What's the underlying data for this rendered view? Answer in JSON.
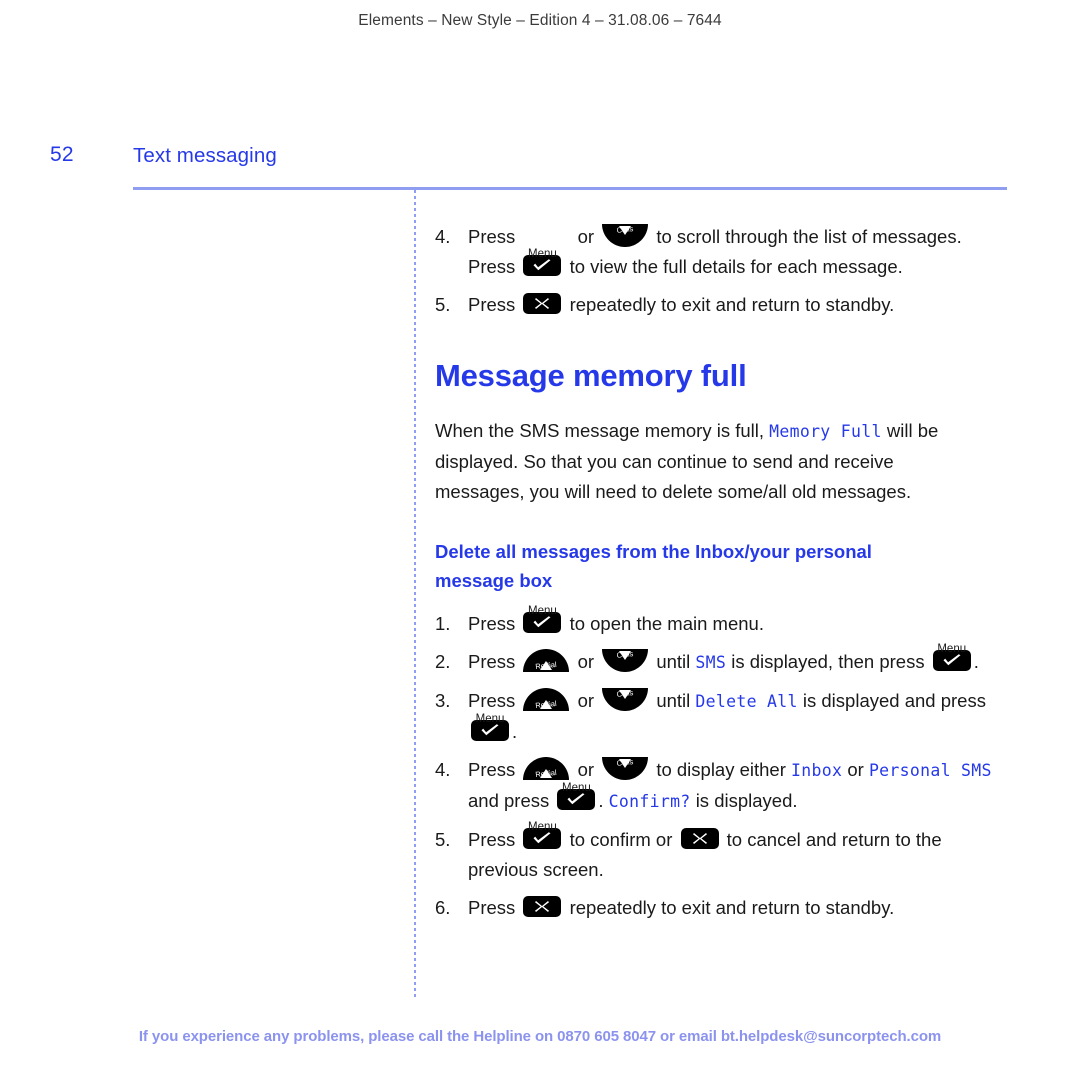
{
  "document": {
    "running_header": "Elements – New Style – Edition 4 – 31.08.06 – 7644",
    "folio": "52",
    "section_title": "Text messaging",
    "footer": "If you experience any problems, please call the Helpline on 0870 605 8047 or email bt.helpdesk@suncorptech.com"
  },
  "keys": {
    "menu_caption": "Menu",
    "redial_caption": "Redial",
    "calls_caption": "Calls"
  },
  "first_list": {
    "step4": {
      "num": "4.",
      "t1": "Press",
      "t2": "or",
      "t3": "to scroll through the list of messages.",
      "t4": "Press",
      "t5": "to view the full details for each message."
    },
    "step5": {
      "num": "5.",
      "t1": "Press",
      "t2": "repeatedly to exit and return to standby."
    }
  },
  "heading": "Message memory full",
  "paragraph": {
    "t1": "When the SMS message memory is full,",
    "lcd1": "Memory Full",
    "t2": "will be displayed. So that you can continue to send and receive messages, you will need to delete some/all old messages."
  },
  "subheading": "Delete all messages from the Inbox/your personal message box",
  "second_list": {
    "step1": {
      "num": "1.",
      "t1": "Press",
      "t2": "to open the main menu."
    },
    "step2": {
      "num": "2.",
      "t1": "Press",
      "t2": "or",
      "t3": "until",
      "lcd1": "SMS",
      "t4": "is displayed, then press",
      "t5": "."
    },
    "step3": {
      "num": "3.",
      "t1": "Press",
      "t2": "or",
      "t3": "until",
      "lcd1": "Delete All",
      "t4": "is displayed and press",
      "t5": "."
    },
    "step4": {
      "num": "4.",
      "t1": "Press",
      "t2": "or",
      "t3": "to display either",
      "lcd1": "Inbox",
      "t4": "or",
      "lcd2": "Personal SMS",
      "t5": "and press",
      "t6": ".",
      "lcd3": "Confirm?",
      "t7": "is displayed."
    },
    "step5": {
      "num": "5.",
      "t1": "Press",
      "t2": "to confirm or",
      "t3": "to cancel and return to the previous screen."
    },
    "step6": {
      "num": "6.",
      "t1": "Press",
      "t2": "repeatedly to exit and return to standby."
    }
  }
}
